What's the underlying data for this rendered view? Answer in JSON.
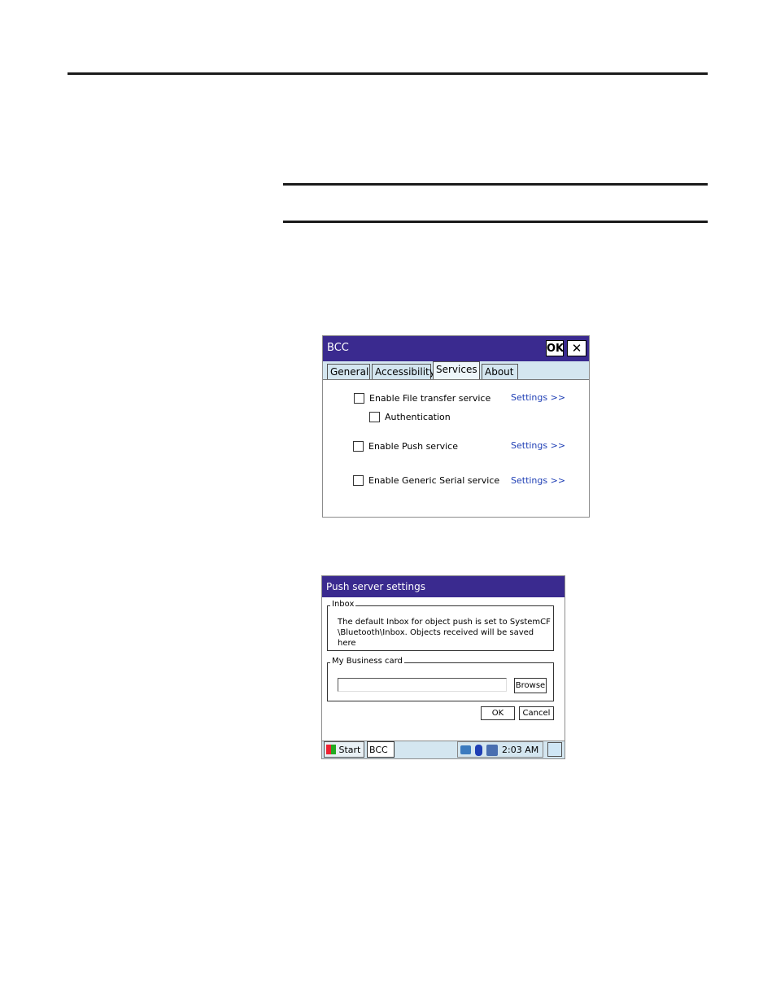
{
  "bcc_dialog": {
    "title": "BCC",
    "ok_label": "OK",
    "close_label": "✕",
    "tabs": [
      {
        "label": "General",
        "active": false
      },
      {
        "label": "Accessibility",
        "active": false
      },
      {
        "label": "Services",
        "active": true
      },
      {
        "label": "About",
        "active": false
      }
    ],
    "services": [
      {
        "label": "Enable File transfer service",
        "checked": false,
        "settings_label": "Settings >>"
      },
      {
        "label": "Authentication",
        "checked": false
      },
      {
        "label": "Enable Push service",
        "checked": false,
        "settings_label": "Settings >>"
      },
      {
        "label": "Enable Generic Serial service",
        "checked": false,
        "settings_label": "Settings >>"
      }
    ]
  },
  "push_dialog": {
    "title": "Push server settings",
    "inbox_group_label": "Inbox",
    "inbox_text_line1": "The default Inbox for object push is set to SystemCF",
    "inbox_text_line2": "\\Bluetooth\\Inbox. Objects received will be saved here",
    "card_group_label": "My Business card",
    "card_value": "",
    "browse_label": "Browse",
    "ok_label": "OK",
    "cancel_label": "Cancel"
  },
  "taskbar": {
    "start_label": "Start",
    "app_label": "BCC",
    "time": "2:03 AM"
  },
  "colors": {
    "titlebar": "#3a2a8f",
    "dialog_bg": "#d4e6f0",
    "link": "#1f3fb5"
  }
}
